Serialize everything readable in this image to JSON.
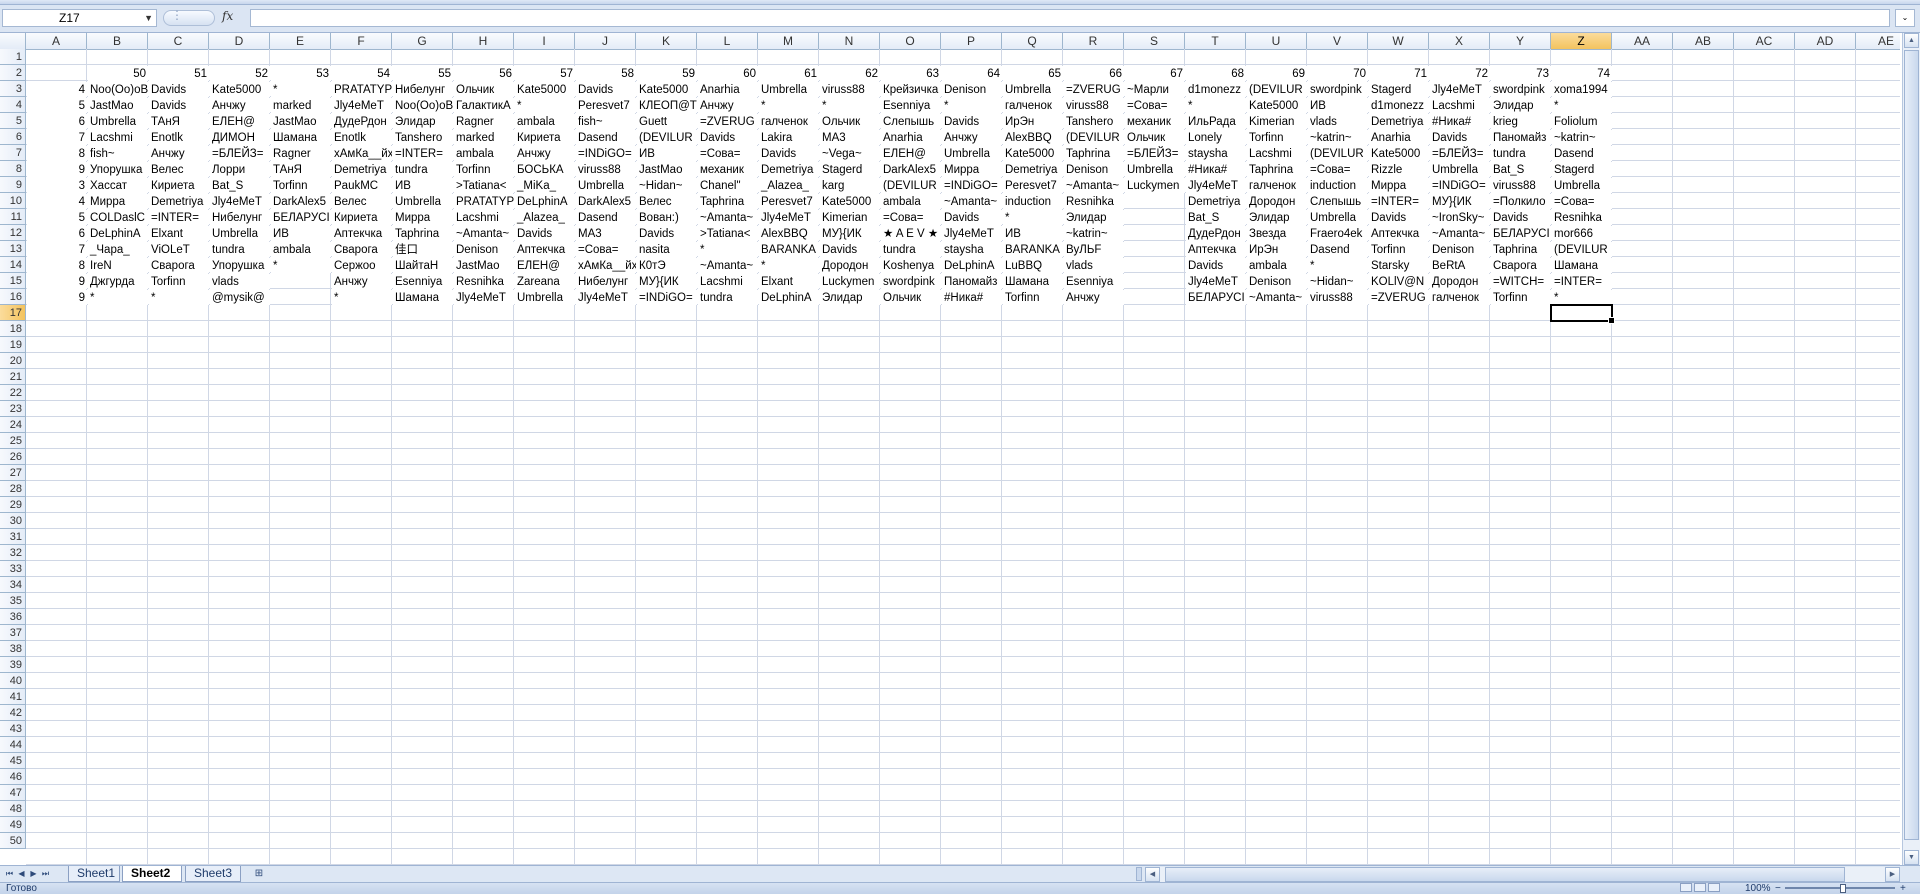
{
  "name_box": {
    "value": "Z17"
  },
  "formula_bar": {
    "fx_label": "fx",
    "value": ""
  },
  "columns": [
    "A",
    "B",
    "C",
    "D",
    "E",
    "F",
    "G",
    "H",
    "I",
    "J",
    "K",
    "L",
    "M",
    "N",
    "O",
    "P",
    "Q",
    "R",
    "S",
    "T",
    "U",
    "V",
    "W",
    "X",
    "Y",
    "Z",
    "AA",
    "AB",
    "AC",
    "AD",
    "AE"
  ],
  "row_count": 50,
  "selected_cell": {
    "col": "Z",
    "row": 17
  },
  "header_row": {
    "row": 2,
    "values": [
      "",
      "50",
      "51",
      "52",
      "53",
      "54",
      "55",
      "56",
      "57",
      "58",
      "59",
      "60",
      "61",
      "62",
      "63",
      "64",
      "65",
      "66",
      "67",
      "68",
      "69",
      "70",
      "71",
      "72",
      "73",
      "74"
    ]
  },
  "rows": [
    {
      "row": 3,
      "a": "4",
      "cells": [
        "Noo(Oo)oB",
        "Davids",
        "Kate5000",
        "*",
        "PRATATYP",
        "Нибелунг",
        "Ольчик",
        "Kate5000",
        "Davids",
        "Kate5000",
        "Anarhia",
        "Umbrella",
        "viruss88",
        "Крейзичка",
        "Denison",
        "Umbrella",
        "=ZVERUG",
        "~Марли",
        "d1monezz",
        "(DEVILUR",
        "swordpink",
        "Stagerd",
        "Jly4eMeT",
        "swordpink",
        "xoma1994"
      ]
    },
    {
      "row": 4,
      "a": "5",
      "cells": [
        "JastMao",
        "Davids",
        "Анчжу",
        "marked",
        "Jly4eMeT",
        "Noo(Oo)oB",
        "ГалактикА",
        "*",
        "Peresvet7",
        "КЛЕОП@Т",
        "Анчжу",
        "*",
        "*",
        "Esenniya",
        "*",
        "галченок",
        "viruss88",
        "=Сова=",
        "*",
        "Kate5000",
        "ИВ",
        "d1monezz",
        "Lacshmi",
        "Элидар",
        "*"
      ]
    },
    {
      "row": 5,
      "a": "6",
      "cells": [
        "Umbrella",
        "ТАнЯ",
        "ЕЛЕН@",
        "JastMao",
        "ДудеРдон",
        "Элидар",
        "Ragner",
        "ambala",
        "fish~",
        "Guett",
        "=ZVERUG",
        "галченок",
        "Ольчик",
        "Слепышь",
        "Davids",
        "ИрЭн",
        "Tanshero",
        "механик",
        "ИльРада",
        "Kimerian",
        "vlads",
        "Demetriya",
        "#Ника#",
        "krieg",
        "Foliolum"
      ]
    },
    {
      "row": 6,
      "a": "7",
      "cells": [
        "Lacshmi",
        "Enotlk",
        "ДИМОН",
        "Шамана",
        "Enotlk",
        "Tanshero",
        "marked",
        "Кириета",
        "Dasend",
        "(DEVILUR",
        "Davids",
        "Lakira",
        "MA3",
        "Anarhia",
        "Анчжу",
        "AlexBBQ",
        "(DEVILUR",
        "Ольчик",
        "Lonely",
        "Torfinn",
        "~katrin~",
        "Anarhia",
        "Davids",
        "Паномайз",
        "~katrin~"
      ]
    },
    {
      "row": 7,
      "a": "8",
      "cells": [
        "fish~",
        "Анчжу",
        "=БЛЕЙЗ=",
        "Ragner",
        "хАмКа__йх",
        "=INTER=",
        "ambala",
        "Анчжу",
        "=INDiGO=",
        "ИВ",
        "=Сова=",
        "Davids",
        "~Vega~",
        "ЕЛЕН@",
        "Umbrella",
        "Kate5000",
        "Taphrina",
        "=БЛЕЙЗ=",
        "staysha",
        "Lacshmi",
        "(DEVILUR",
        "Kate5000",
        "=БЛЕЙЗ=",
        "tundra",
        "Dasend"
      ]
    },
    {
      "row": 8,
      "a": "9",
      "cells": [
        "Упорушка",
        "Велес",
        "Лорри",
        "ТАнЯ",
        "Demetriya",
        "tundra",
        "Torfinn",
        "БОСЬКА",
        "viruss88",
        "JastMao",
        "механик",
        "Demetriya",
        "Stagerd",
        "DarkAlex5",
        "Мирра",
        "Demetriya",
        "Denison",
        "Umbrella",
        "#Ника#",
        "Taphrina",
        "=Сова=",
        "Rizzle",
        "Umbrella",
        "Bat_S",
        "Stagerd"
      ]
    },
    {
      "row": 9,
      "a": "3",
      "cells": [
        "Хассат",
        "Кириета",
        "Bat_S",
        "Torfinn",
        "PaukMC",
        "ИВ",
        ">Tatiana<",
        "_MiKa_",
        "Umbrella",
        "~Hidan~",
        "Chanel\"",
        "_Alazea_",
        "karg",
        "(DEVILUR",
        "=INDiGO=",
        "Peresvet7",
        "~Amanta~",
        "Luckymen",
        "Jly4eMeT",
        "галченок",
        "induction",
        "Мирра",
        "=INDiGO=",
        "viruss88",
        "Umbrella"
      ]
    },
    {
      "row": 10,
      "a": "4",
      "cells": [
        "Мирра",
        "Demetriya",
        "Jly4eMeT",
        "DarkAlex5",
        "Велес",
        "Umbrella",
        "PRATATYP",
        "DeLphinA",
        "DarkAlex5",
        "Велес",
        "Taphrina",
        "Peresvet7",
        "Kate5000",
        "ambala",
        "~Amanta~",
        "induction",
        "Resnihka",
        "",
        "Demetriya",
        "Дородон",
        "Слепышь",
        "=INTER=",
        "МУ}{ИК",
        "=Полкило",
        "=Сова="
      ]
    },
    {
      "row": 11,
      "a": "5",
      "cells": [
        "COLDaslC",
        "=INTER=",
        "Нибелунг",
        "БЕЛАРУСІ",
        "Кириета",
        "Мирра",
        "Lacshmi",
        "_Alazea_",
        "Dasend",
        "Вован:)",
        "~Amanta~",
        "Jly4eMeT",
        "Kimerian",
        "=Сова=",
        "Davids",
        "*",
        "Элидар",
        "",
        "Bat_S",
        "Элидар",
        "Umbrella",
        "Davids",
        "~IronSky~",
        "Davids",
        "Resnihka"
      ]
    },
    {
      "row": 12,
      "a": "6",
      "cells": [
        "DeLphinA",
        "Elxant",
        "Umbrella",
        "ИВ",
        "Аптекчка",
        "Taphrina",
        "~Amanta~",
        "Davids",
        "MA3",
        "Davids",
        ">Tatiana<",
        "AlexBBQ",
        "МУ}{ИК",
        "★ A E V ★",
        "Jly4eMeT",
        "ИВ",
        "~katrin~",
        "",
        "ДудеРдон",
        "Звезда",
        "Fraero4ek",
        "Аптекчка",
        "~Amanta~",
        "БЕЛАРУСІ",
        "mor666"
      ]
    },
    {
      "row": 13,
      "a": "7",
      "cells": [
        "_Чара_",
        "ViOLeT",
        "tundra",
        "ambala",
        "Сварога",
        "佳口",
        "Denison",
        "Аптекчка",
        "=Сова=",
        "nasita",
        "*",
        "BARANKA",
        "Davids",
        "tundra",
        "staysha",
        "BARANKA",
        "ВуЛЬF",
        "",
        "Аптекчка",
        "ИрЭн",
        "Dasend",
        "Torfinn",
        "Denison",
        "Taphrina",
        "(DEVILUR"
      ]
    },
    {
      "row": 14,
      "a": "8",
      "cells": [
        "IreN",
        "Сварога",
        "Упорушка",
        "*",
        "Сержоо",
        "ШайтаН",
        "JastMao",
        "ЕЛЕН@",
        "хАмКа__йх",
        "К0тЭ",
        "~Amanta~",
        "*",
        "Дородон",
        "Koshenya",
        "DeLphinA",
        "LuBBQ",
        "vlads",
        "",
        "Davids",
        "ambala",
        "*",
        "Starsky",
        "BeRtA",
        "Сварога",
        "Шамана"
      ]
    },
    {
      "row": 15,
      "a": "9",
      "cells": [
        "Джгурда",
        "Torfinn",
        "vlads",
        "",
        "Анчжу",
        "Esenniya",
        "Resnihka",
        "Zareana",
        "Нибелунг",
        "МУ}{ИК",
        "Lacshmi",
        "Elxant",
        "Luckymen",
        "swordpink",
        "Паномайз",
        "Шамана",
        "Esenniya",
        "",
        "Jly4eMeT",
        "Denison",
        "~Hidan~",
        "KOLlV@N",
        "Дородон",
        "=WITCH=",
        "=INTER="
      ]
    },
    {
      "row": 16,
      "a": "9",
      "cells": [
        "*",
        "*",
        "@mysik@",
        "",
        "*",
        "Шамана",
        "Jly4eMeT",
        "Umbrella",
        "Jly4eMeT",
        "=INDiGO=",
        "tundra",
        "DeLphinA",
        "Элидар",
        "Ольчик",
        "#Ника#",
        "Torfinn",
        "Анчжу",
        "",
        "БЕЛАРУСІ",
        "~Amanta~",
        "viruss88",
        "=ZVERUG",
        "галченок",
        "Torfinn",
        "*"
      ]
    }
  ],
  "sheet_tabs": [
    "Sheet1",
    "Sheet2",
    "Sheet3"
  ],
  "active_sheet": "Sheet2",
  "status": {
    "text": "Готово",
    "zoom": "100%"
  }
}
